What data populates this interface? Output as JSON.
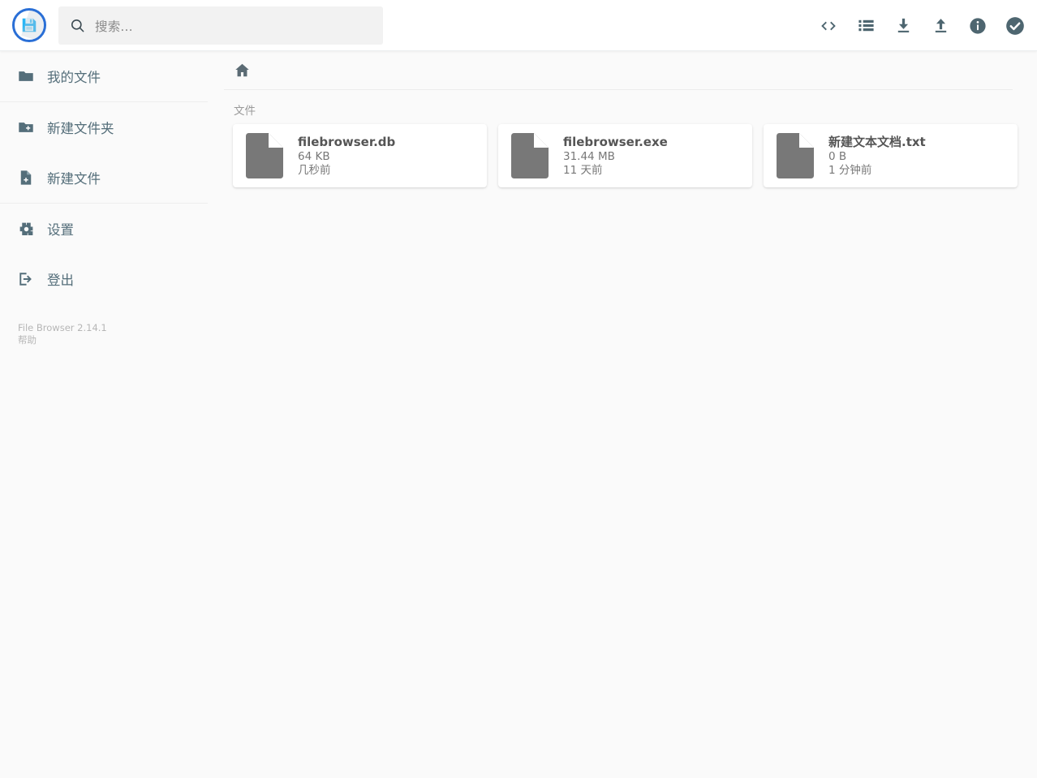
{
  "app": {
    "logo_icon": "floppy-disk-save-icon",
    "accent_color": "#2a6fd6"
  },
  "search": {
    "placeholder": "搜索...",
    "value": "",
    "icon": "search-icon"
  },
  "header": {
    "actions": [
      {
        "name": "code-brackets-icon",
        "label": "<>"
      },
      {
        "name": "list-view-icon",
        "label": "列表视图"
      },
      {
        "name": "download-icon",
        "label": "下载"
      },
      {
        "name": "upload-icon",
        "label": "上传"
      },
      {
        "name": "info-icon",
        "label": "信息"
      },
      {
        "name": "check-circle-icon",
        "label": "全选"
      }
    ]
  },
  "sidebar": {
    "groups": [
      {
        "items": [
          {
            "label": "我的文件",
            "icon": "folder-icon"
          }
        ]
      },
      {
        "items": [
          {
            "label": "新建文件夹",
            "icon": "folder-plus-icon"
          },
          {
            "label": "新建文件",
            "icon": "file-plus-icon"
          }
        ]
      },
      {
        "items": [
          {
            "label": "设置",
            "icon": "gear-icon"
          },
          {
            "label": "登出",
            "icon": "logout-icon"
          }
        ]
      }
    ],
    "footer": {
      "version": "File Browser 2.14.1",
      "help": "帮助"
    }
  },
  "main": {
    "breadcrumb": {
      "home_icon": "home-icon"
    },
    "section_label": "文件",
    "files": [
      {
        "name": "filebrowser.db",
        "size": "64 KB",
        "modified": "几秒前",
        "icon": "file-icon"
      },
      {
        "name": "filebrowser.exe",
        "size": "31.44 MB",
        "modified": "11 天前",
        "icon": "file-icon"
      },
      {
        "name": "新建文本文档.txt",
        "size": "0 B",
        "modified": "1 分钟前",
        "icon": "file-icon"
      }
    ]
  }
}
